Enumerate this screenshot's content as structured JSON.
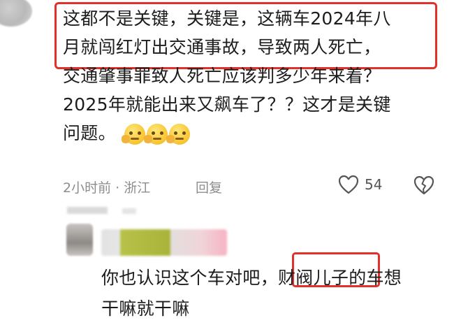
{
  "comment": {
    "lines": [
      "这都不是关键，关键是，这辆车2024年八",
      "月就闯红灯出交通事故，导致两人死亡，",
      "交通肇事罪致人死亡应该判多少年来着？",
      "2025年就能出来又飙车了？？这才是关键",
      "问题。"
    ],
    "emoji_icons": [
      "thinking-face-icon",
      "thinking-face-icon",
      "thinking-face-icon"
    ],
    "time": "2小时前 · 浙江",
    "reply_label": "回复",
    "like_count": "54"
  },
  "reply": {
    "lines": [
      "你也认识这个车对吧，财阀儿子的车想",
      "干嘛就干嘛"
    ]
  },
  "colors": {
    "highlight": "#e0312a",
    "meta_text": "#8d8d8d"
  }
}
